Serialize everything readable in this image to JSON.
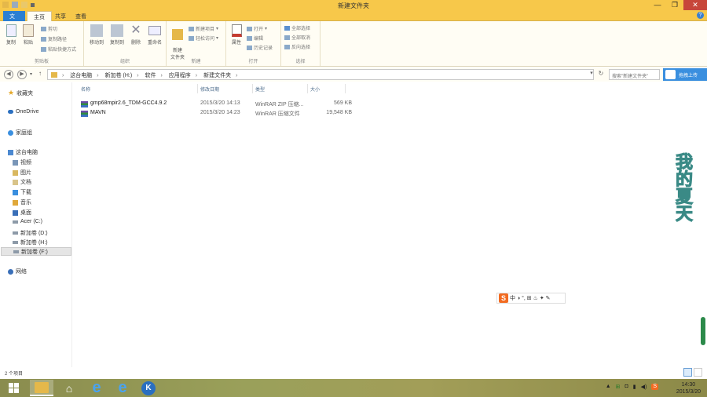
{
  "window": {
    "title": "新建文件夹",
    "controls": [
      "—",
      "❐",
      "✕"
    ]
  },
  "tabs": [
    {
      "label": "文件"
    },
    {
      "label": "主页"
    },
    {
      "label": "共享"
    },
    {
      "label": "查看"
    }
  ],
  "ribbon": {
    "clipboard": {
      "copy": "复制",
      "paste": "粘贴",
      "cut": "剪切",
      "copy_path": "复制路径",
      "paste_shortcut": "粘贴快捷方式",
      "label": "剪贴板"
    },
    "organize": {
      "move_to": "移动到",
      "copy_to": "复制到",
      "delete": "删除",
      "rename": "重命名",
      "label": "组织"
    },
    "new": {
      "new_folder": "新建\n文件夹",
      "new_item": "新建项目",
      "easy_access": "轻松访问",
      "label": "新建"
    },
    "open": {
      "properties": "属性",
      "open": "打开",
      "edit": "编辑",
      "history": "历史记录",
      "label": "打开"
    },
    "select": {
      "select_all": "全部选择",
      "select_none": "全部取消",
      "invert": "反向选择",
      "label": "选择"
    }
  },
  "address": {
    "crumbs": [
      "这台电脑",
      "新加卷 (H:)",
      "软件",
      "应用程序",
      "新建文件夹"
    ],
    "search_placeholder": "搜索\"新建文件夹\"",
    "upload_label": "拖拽上传"
  },
  "sidebar": {
    "favorites": "收藏夹",
    "onedrive": "OneDrive",
    "homegroup": "家庭组",
    "this_pc": "这台电脑",
    "items": [
      {
        "label": "视频"
      },
      {
        "label": "图片"
      },
      {
        "label": "文档"
      },
      {
        "label": "下载"
      },
      {
        "label": "音乐"
      },
      {
        "label": "桌面"
      },
      {
        "label": "Acer (C:)"
      },
      {
        "label": "新加卷 (D:)"
      },
      {
        "label": "新加卷 (H:)"
      },
      {
        "label": "新加卷 (F:)"
      }
    ],
    "network": "网络"
  },
  "columns": {
    "name": "名称",
    "date": "修改日期",
    "type": "类型",
    "size": "大小"
  },
  "files": [
    {
      "name": "gmp68mpir2.6_TDM-GCC4.9.2",
      "date": "2015/3/20 14:13",
      "type": "WinRAR ZIP 压缩...",
      "size": "569 KB"
    },
    {
      "name": "MAVN",
      "date": "2015/3/20 14:23",
      "type": "WinRAR 压缩文件",
      "size": "19,548 KB"
    }
  ],
  "status": {
    "count": "2 个项目"
  },
  "ime": {
    "chars": "中 ◑ °, ⊞ ♨ ✦ ✎"
  },
  "watermark": {
    "text": "我的夏天"
  },
  "taskbar": {
    "ie1": "e",
    "ie2": "e",
    "k": "K",
    "tray": [
      "▲",
      "⊞",
      "◘",
      "▮",
      "◀)",
      "S"
    ]
  },
  "clock": {
    "time": "14:30",
    "date": "2015/3/20"
  },
  "colors": {
    "titlebar": "#f7c84a",
    "file_tab": "#2b7fd3",
    "upload": "#3a8fdf"
  }
}
